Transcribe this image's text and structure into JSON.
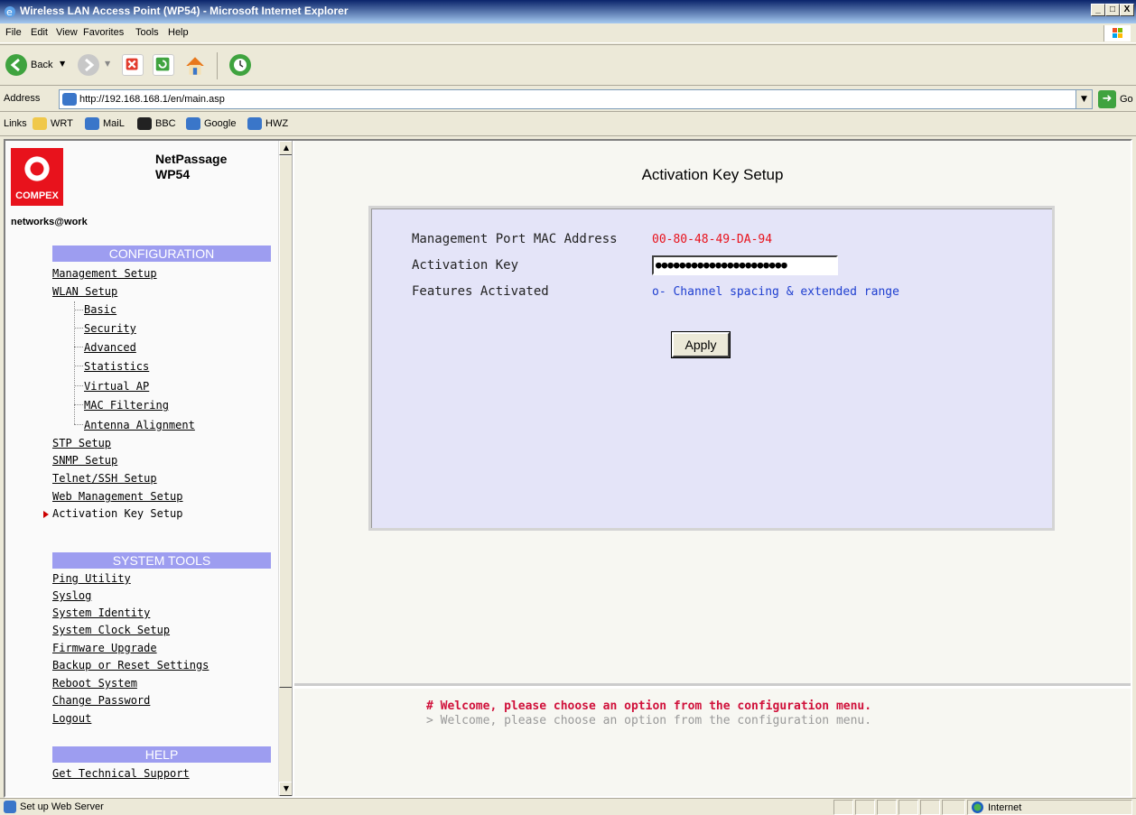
{
  "window": {
    "title": "Wireless LAN Access Point (WP54) - Microsoft Internet Explorer",
    "min_glyph": "_",
    "max_glyph": "□",
    "close_glyph": "X"
  },
  "menu": [
    "File",
    "Edit",
    "View",
    "Favorites",
    "Tools",
    "Help"
  ],
  "toolbar": {
    "back_label": "Back"
  },
  "address": {
    "label": "Address",
    "url": "http://192.168.168.1/en/main.asp",
    "go_label": "Go"
  },
  "links": {
    "label": "Links",
    "items": [
      "WRT",
      "MaiL",
      "BBC",
      "Google",
      "HWZ"
    ]
  },
  "sidebar": {
    "brand": "COMPEX",
    "product_line1": "NetPassage",
    "product_line2": "WP54",
    "tagline": "networks@work",
    "config_header": "CONFIGURATION",
    "config_items": [
      "Management Setup",
      "WLAN Setup"
    ],
    "wlan_subitems": [
      "Basic",
      "Security",
      "Advanced",
      "Statistics",
      "Virtual AP",
      "MAC Filtering",
      "Antenna Alignment"
    ],
    "more_config_items": [
      "STP Setup",
      "SNMP Setup",
      "Telnet/SSH Setup",
      "Web Management Setup",
      "Activation Key Setup"
    ],
    "tools_header": "SYSTEM TOOLS",
    "tools_items": [
      "Ping Utility",
      "Syslog",
      "System Identity",
      "System Clock Setup",
      "Firmware Upgrade",
      "Backup or Reset Settings",
      "Reboot System",
      "Change Password",
      "Logout"
    ],
    "help_header": "HELP",
    "help_items": [
      "Get Technical Support"
    ]
  },
  "main": {
    "title": "Activation Key Setup",
    "mac_label": "Management Port MAC Address",
    "mac_value": "00-80-48-49-DA-94",
    "key_label": "Activation Key",
    "key_value": "●●●●●●●●●●●●●●●●●●●●●●",
    "features_label": "Features Activated",
    "features_value": "o- Channel spacing & extended range",
    "apply_label": "Apply",
    "mac_color": "#e8121c",
    "features_color": "#1f3fd0"
  },
  "messages": {
    "line1": "# Welcome, please choose an option from the configuration menu.",
    "line2": "> Welcome, please choose an option from the configuration menu."
  },
  "status": {
    "text": "Set up Web Server",
    "zone": "Internet"
  }
}
